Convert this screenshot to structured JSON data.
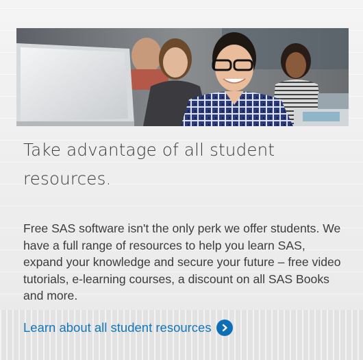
{
  "card": {
    "image_alt": "Group of smiling students, one with glasses in a plaid shirt, next to a computer monitor",
    "title": "Take advantage of all student resources.",
    "body": "Free SAS software isn't the only perk we offer students. We have a full range of resources to help you learn SAS, expand your knowledge and secure your future – free video tutorials, e-learning courses, a discount on all SAS Books and more.",
    "link_label": "Learn about all student resources",
    "link_icon": "chevron-right-circle-icon"
  },
  "colors": {
    "link": "#1476b9",
    "icon_bg": "#0f6fb6",
    "text": "#3b3b3b"
  }
}
